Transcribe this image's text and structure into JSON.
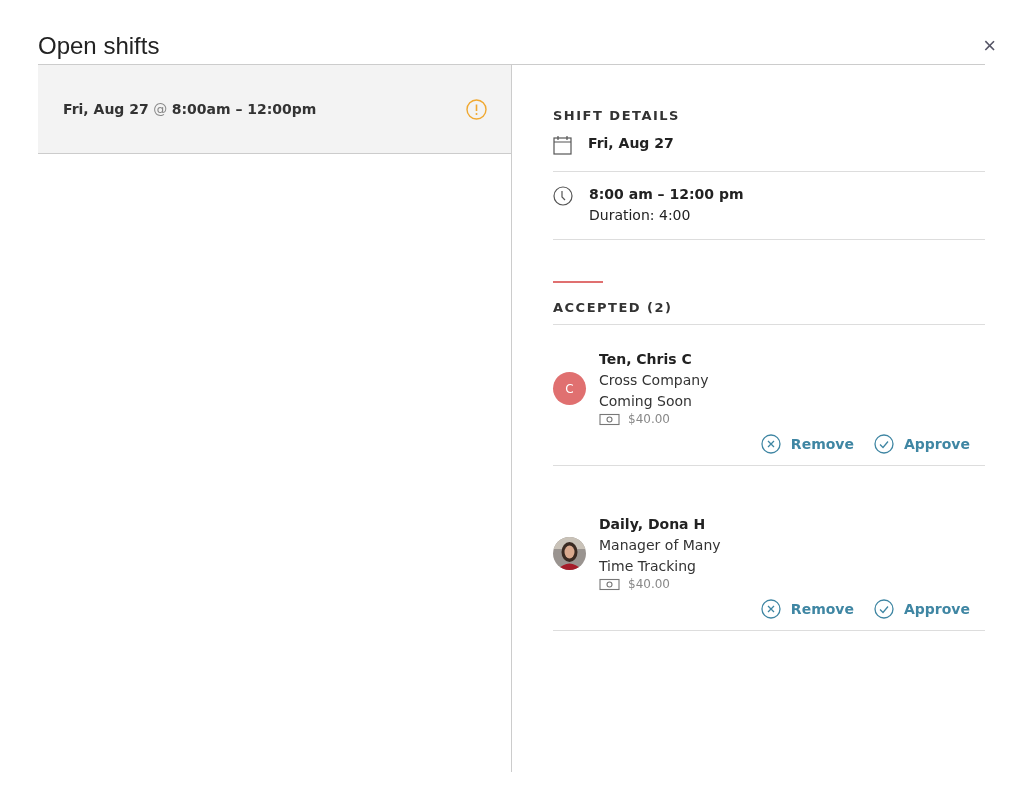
{
  "dialog": {
    "title": "Open shifts",
    "close": "×"
  },
  "shifts": [
    {
      "label": "**Fri, Aug 27** @ **8:00am – 12:00pm**",
      "selected": true,
      "warning": true
    }
  ],
  "details": {
    "heading": "SHIFT DETAILS",
    "date": "Fri, Aug 27",
    "time": "8:00 am – 12:00 pm",
    "duration": "Duration: 4:00"
  },
  "accepted": {
    "heading": "ACCEPTED (2)",
    "people": [
      {
        "name": "Ten, Chris C",
        "avatar": {
          "kind": "initial",
          "text": "C",
          "color": "#e07070"
        },
        "lines": [
          "Cross Company",
          "Coming Soon"
        ],
        "pay": "$40.00",
        "actions": [
          "Remove",
          "Approve"
        ]
      },
      {
        "name": "Daily, Dona H",
        "lines": [
          "Manager of Many",
          "Time Tracking"
        ],
        "pay": "$40.00",
        "actions": [
          "Remove",
          "Approve"
        ]
      }
    ]
  }
}
